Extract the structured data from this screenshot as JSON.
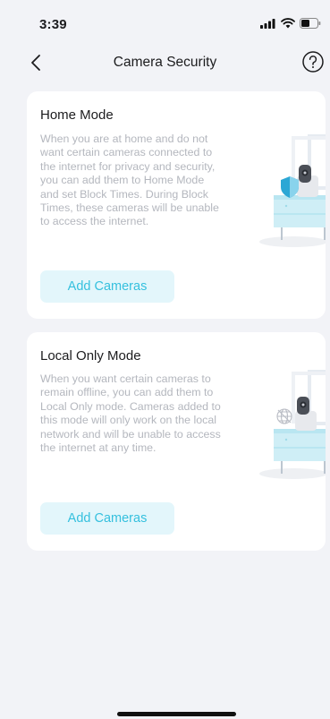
{
  "status_bar": {
    "time": "3:39"
  },
  "nav": {
    "title": "Camera Security"
  },
  "cards": [
    {
      "title": "Home Mode",
      "description": "When you are at home and do not want certain cameras connected to the internet for privacy and security, you can add them to Home Mode and set Block Times. During Block Times, these cameras will be unable to access the internet.",
      "button_label": "Add Cameras"
    },
    {
      "title": "Local Only Mode",
      "description": "When you want certain cameras to remain offline, you can add them to Local Only mode. Cameras added to this mode will only work on the local network and will be unable to access the internet at any time.",
      "button_label": "Add Cameras"
    }
  ],
  "colors": {
    "accent": "#35c0de",
    "button_bg": "#e3f6fb",
    "page_bg": "#f2f3f7"
  }
}
